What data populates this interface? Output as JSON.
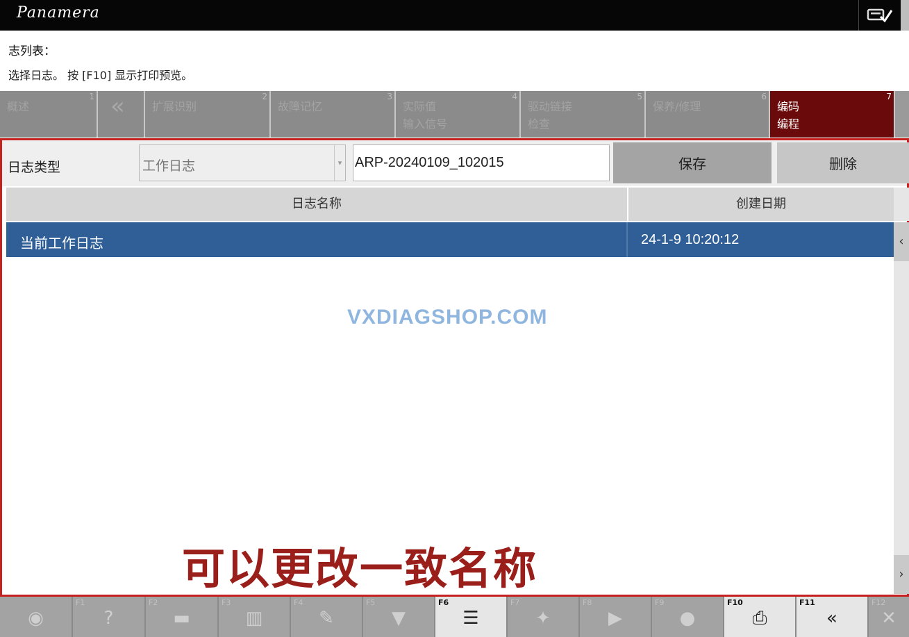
{
  "app": {
    "brand": "Panamera"
  },
  "header": {
    "title": "志列表：",
    "instruction": "选择日志。 按 [F10] 显示打印预览。"
  },
  "tabs": [
    {
      "num": "1",
      "label": "概述"
    },
    {
      "num": "",
      "label": "«"
    },
    {
      "num": "2",
      "label": "扩展识别"
    },
    {
      "num": "3",
      "label": "故障记忆"
    },
    {
      "num": "4",
      "label": "实际值\n输入信号"
    },
    {
      "num": "5",
      "label": "驱动链接\n检查"
    },
    {
      "num": "6",
      "label": "保养/修理"
    },
    {
      "num": "7",
      "label": "编码\n编程"
    }
  ],
  "filter": {
    "label": "日志类型",
    "type_value": "工作日志",
    "name_value": "ARP-20240109_102015",
    "save_label": "保存",
    "delete_label": "删除"
  },
  "table": {
    "columns": [
      "日志名称",
      "创建日期"
    ],
    "rows": [
      {
        "name": "当前工作日志",
        "date": "24-1-9 10:20:12"
      }
    ]
  },
  "watermark": "VXDIAGSHOP.COM",
  "caption": "可以更改一致名称",
  "fkeys": [
    {
      "label": "",
      "icon": "car-info-icon"
    },
    {
      "label": "F1",
      "icon": "help-icon"
    },
    {
      "label": "F2",
      "icon": "message-icon"
    },
    {
      "label": "F3",
      "icon": "chart-icon"
    },
    {
      "label": "F4",
      "icon": "edit-icon"
    },
    {
      "label": "F5",
      "icon": "filter-icon"
    },
    {
      "label": "F6",
      "icon": "list-select-icon"
    },
    {
      "label": "F7",
      "icon": "tools-icon"
    },
    {
      "label": "F8",
      "icon": "play-icon"
    },
    {
      "label": "F9",
      "icon": "chat-icon"
    },
    {
      "label": "F10",
      "icon": "print-icon"
    },
    {
      "label": "F11",
      "icon": "back-icon"
    },
    {
      "label": "F12",
      "icon": "close-icon"
    }
  ]
}
